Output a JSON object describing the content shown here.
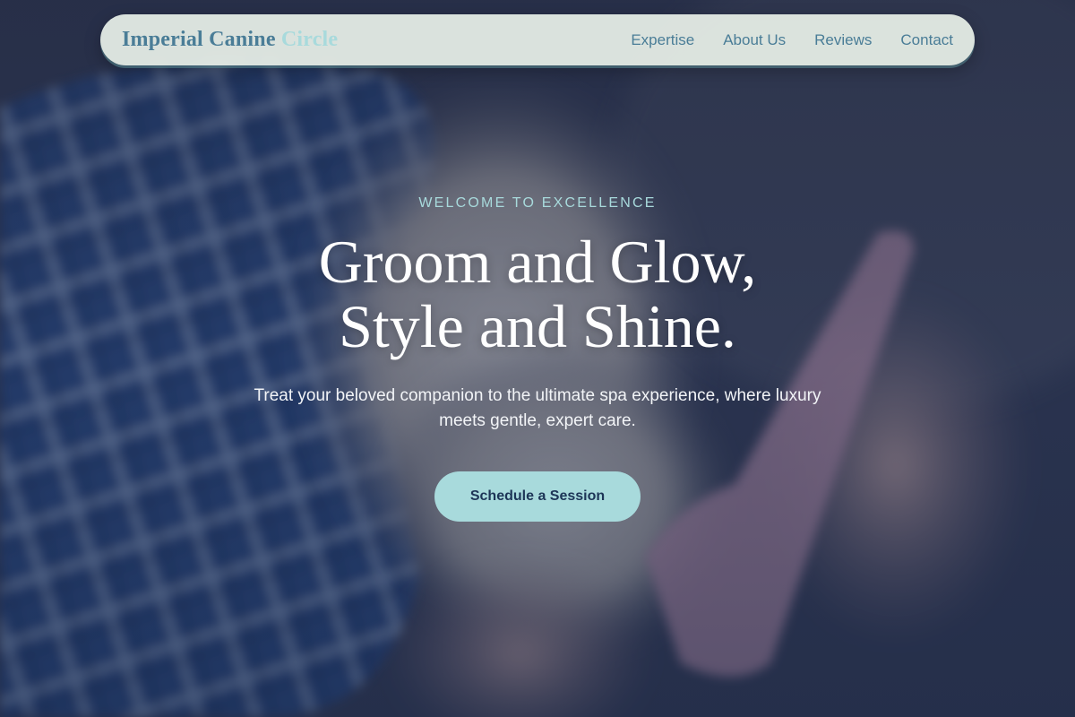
{
  "nav": {
    "brand_main": "Imperial Canine",
    "brand_accent": "Circle",
    "links": [
      {
        "label": "Expertise"
      },
      {
        "label": "About Us"
      },
      {
        "label": "Reviews"
      },
      {
        "label": "Contact"
      }
    ]
  },
  "hero": {
    "eyebrow": "WELCOME TO EXCELLENCE",
    "headline_line1": "Groom and Glow,",
    "headline_line2": "Style and Shine.",
    "subtitle": "Treat your beloved companion to the ultimate spa experience, where luxury meets gentle, expert care.",
    "cta_label": "Schedule a Session"
  },
  "colors": {
    "accent": "#a8dadc",
    "brand_blue": "#4a7d97",
    "cta_text": "#1d3557",
    "nav_bg": "#e8f0e8"
  }
}
